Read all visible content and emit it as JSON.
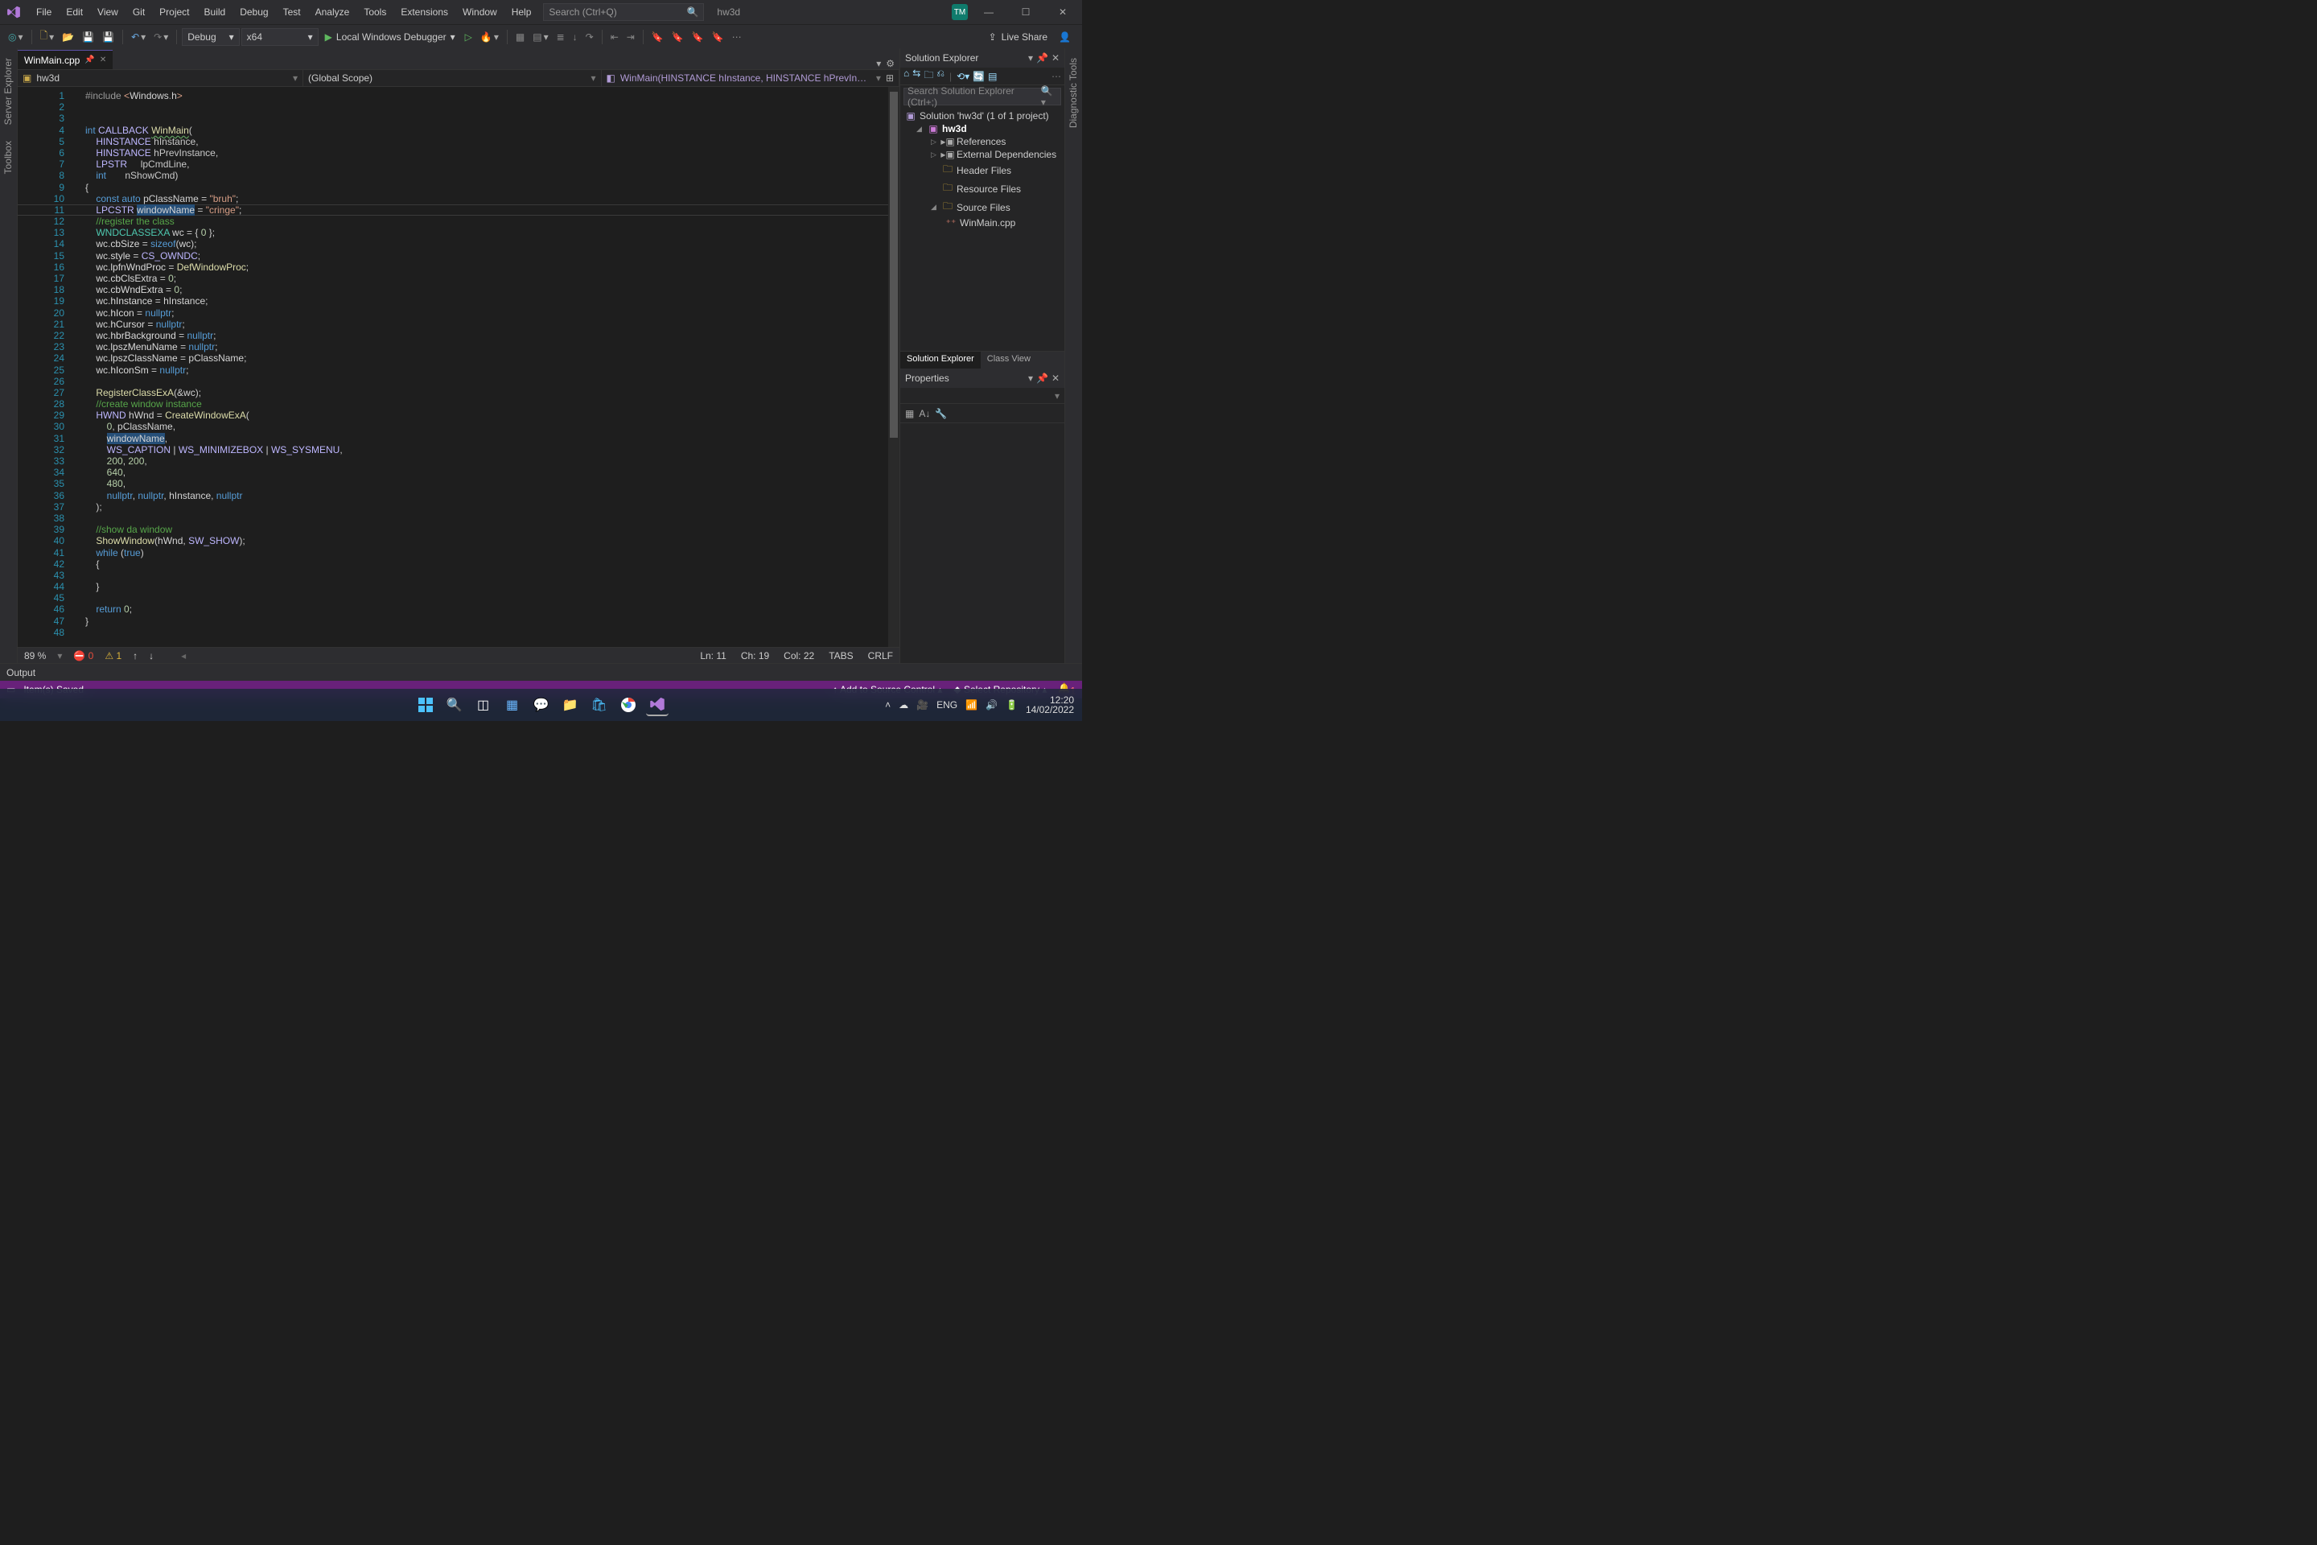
{
  "menubar": {
    "items": [
      "File",
      "Edit",
      "View",
      "Git",
      "Project",
      "Build",
      "Debug",
      "Test",
      "Analyze",
      "Tools",
      "Extensions",
      "Window",
      "Help"
    ],
    "search_placeholder": "Search (Ctrl+Q)",
    "solution_label": "hw3d",
    "user_initials": "TM"
  },
  "toolbar": {
    "config": "Debug",
    "platform": "x64",
    "run_label": "Local Windows Debugger",
    "liveshare": "Live Share"
  },
  "left_rail": [
    "Server Explorer",
    "Toolbox"
  ],
  "right_rail": [
    "Diagnostic Tools"
  ],
  "tabs": {
    "active": "WinMain.cpp"
  },
  "navbar": {
    "project": "hw3d",
    "scope": "(Global Scope)",
    "func": "WinMain(HINSTANCE hInstance, HINSTANCE hPrevInstance, LPSTR lpCmdLine, int nShowCmd)"
  },
  "code_lines": 48,
  "editor_status": {
    "zoom": "89 %",
    "errors": "0",
    "warnings": "1",
    "ln": "Ln: 11",
    "col_ch": "Ch: 19",
    "col": "Col: 22",
    "ins": "TABS",
    "enc": "CRLF"
  },
  "solution_explorer": {
    "title": "Solution Explorer",
    "search_placeholder": "Search Solution Explorer (Ctrl+;)",
    "solution": "Solution 'hw3d' (1 of 1 project)",
    "project": "hw3d",
    "folders": {
      "references": "References",
      "external": "External Dependencies",
      "headers": "Header Files",
      "resources": "Resource Files",
      "sources": "Source Files",
      "file": "WinMain.cpp"
    },
    "tabs": [
      "Solution Explorer",
      "Class View"
    ]
  },
  "properties": {
    "title": "Properties"
  },
  "output": {
    "title": "Output"
  },
  "statusbar": {
    "msg": "Item(s) Saved",
    "source_control": "Add to Source Control",
    "repo": "Select Repository"
  },
  "tray": {
    "time": "12:20",
    "date": "14/02/2022"
  }
}
